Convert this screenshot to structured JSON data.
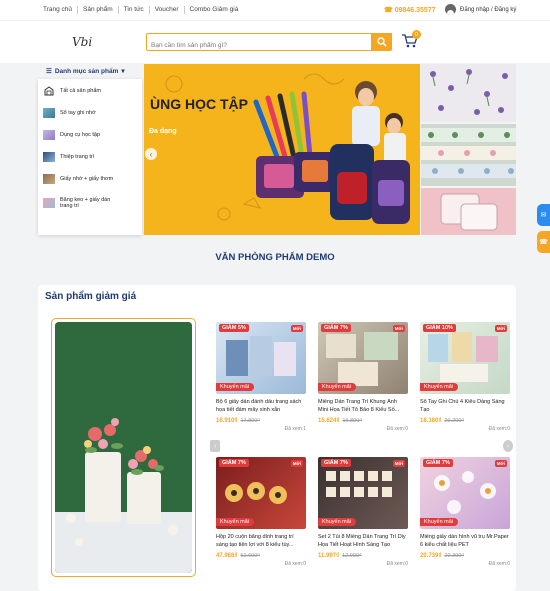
{
  "topnav": [
    "Trang chủ",
    "Sản phẩm",
    "Tin tức",
    "Voucher",
    "Combo Giảm giá"
  ],
  "phone": "09846.35577",
  "login_label": "Đăng nhập / Đăng ký",
  "logo_text": "Vbi",
  "search": {
    "placeholder": "Bạn cần tìm sản phẩm gì?"
  },
  "cart_count": "0",
  "category_button": "Danh mục sản phẩm",
  "categories": [
    "Tất cả sản phẩm",
    "Sổ tay ghi nhớ",
    "Dụng cụ học tập",
    "Thiệp trang trí",
    "Giấy nhớ + giấy thơm",
    "Băng keo + giấy dán trang trí"
  ],
  "banner": {
    "headline": "ÙNG HỌC TẬP",
    "subtext": "Đa dạng"
  },
  "site_title": "VĂN PHÒNG PHẨM DEMO",
  "discount_section": {
    "title": "Sản phẩm giảm giá",
    "products": [
      {
        "discount": "GIẢM 5%",
        "tag": "Mới",
        "promo": "Khuyến mãi",
        "name": "Bộ 6 giấy dán đánh dấu trang sách họa tiết đám mây xinh xắn",
        "price": "16.910₫",
        "old_price": "17.800₫",
        "views": "Đã xem:1"
      },
      {
        "discount": "GIẢM 7%",
        "tag": "Mới",
        "promo": "Khuyến mãi",
        "name": "Miếng Dán Trang Trí Khung Ảnh Mini Họa Tiết Tô Bảo 8 Kiểu Số...",
        "price": "15.624₫",
        "old_price": "16.800₫",
        "views": "Đã xem:0"
      },
      {
        "discount": "GIẢM 10%",
        "tag": "Mới",
        "promo": "Khuyến mãi",
        "name": "Sổ Tay Ghi Chú 4 Kiểu Dáng Sáng Tạo",
        "price": "18.180₫",
        "old_price": "20.200₫",
        "views": "Đã xem:0"
      },
      {
        "discount": "GIẢM 7%",
        "tag": "Mới",
        "promo": "Khuyến mãi",
        "name": "Hộp 20 cuộn băng dính trang trí sáng tạo tiện lợi với 8 kiểu tùy...",
        "price": "47.988₫",
        "old_price": "51.600₫",
        "views": "Đã xem:0"
      },
      {
        "discount": "GIẢM 7%",
        "tag": "Mới",
        "promo": "Khuyến mãi",
        "name": "Set 2 Túi 8 Miếng Dán Trang Trí Diy Họa Tiết Hoạt Hình Sáng Tạo",
        "price": "11.997₫",
        "old_price": "12.900₫",
        "views": "Đã xem:0"
      },
      {
        "discount": "GIẢM 7%",
        "tag": "Mới",
        "promo": "Khuyến mãi",
        "name": "Miếng giấy dán hình vũ trụ Mr.Paper 6 kiểu chất liệu PET",
        "price": "20.739₫",
        "old_price": "22.300₫",
        "views": "Đã xem:0"
      }
    ]
  },
  "colors": {
    "accent": "#f5a623",
    "navy": "#1f3b73",
    "sale": "#e23b3b"
  }
}
